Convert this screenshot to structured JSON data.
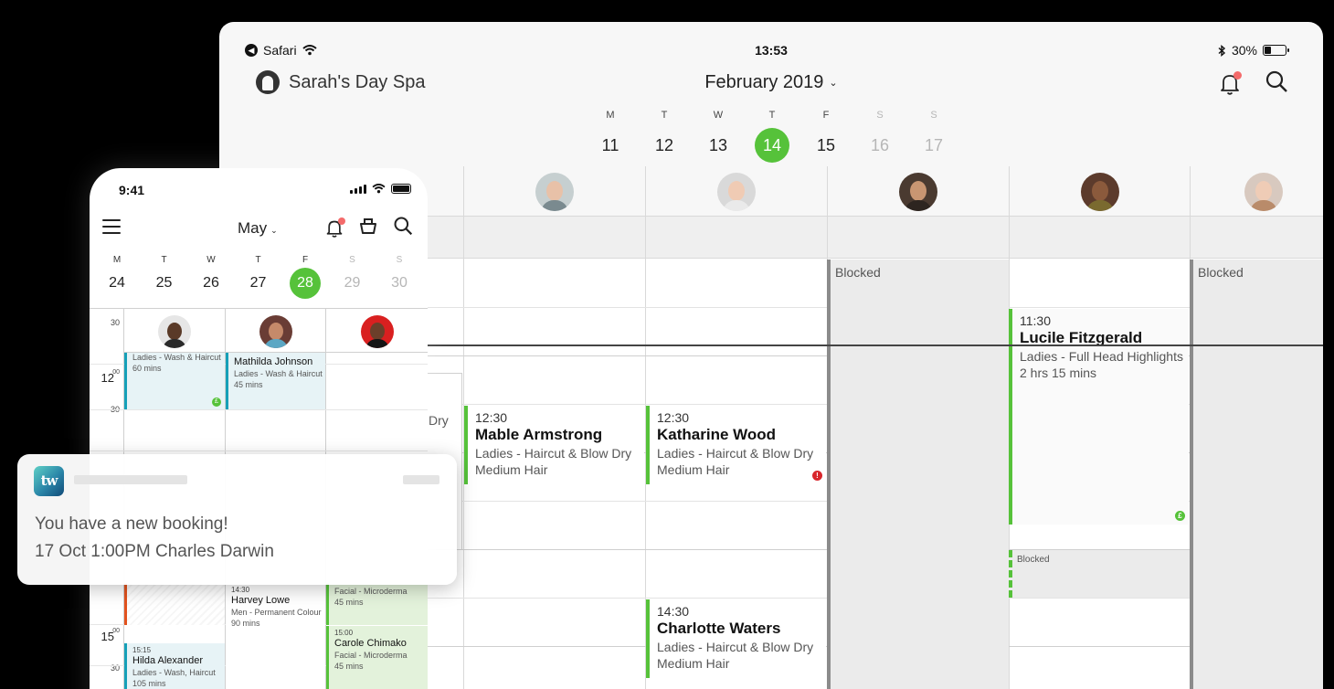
{
  "tablet": {
    "status": {
      "back_app": "Safari",
      "time": "13:53",
      "battery": "30%",
      "battery_level": 0.3
    },
    "business_name": "Sarah's Day Spa",
    "month": "February 2019",
    "week": [
      {
        "label": "M",
        "num": "11"
      },
      {
        "label": "T",
        "num": "12"
      },
      {
        "label": "W",
        "num": "13"
      },
      {
        "label": "T",
        "num": "14",
        "selected": true
      },
      {
        "label": "F",
        "num": "15"
      },
      {
        "label": "S",
        "num": "16",
        "weekend": true
      },
      {
        "label": "S",
        "num": "17",
        "weekend": true
      }
    ],
    "blocked_label": "Blocked",
    "appointments": [
      {
        "time": "12:30",
        "name": "Mable Armstrong",
        "service": "Ladies - Haircut & Blow Dry",
        "detail": "Medium Hair"
      },
      {
        "time": "12:30",
        "name": "Katharine Wood",
        "service": "Ladies - Haircut & Blow Dry",
        "detail": "Medium Hair"
      },
      {
        "time": "11:30",
        "name": "Lucile Fitzgerald",
        "service": "Ladies - Full Head Highlights",
        "detail": "2 hrs 15 mins"
      },
      {
        "time": "14:30",
        "name": "Charlotte Waters",
        "service": "Ladies - Haircut & Blow Dry",
        "detail": "Medium Hair"
      }
    ],
    "partial_text": {
      "left_1": "w Dry",
      "left_2": ")"
    },
    "colors": {
      "accent": "#56c23a",
      "alert": "#d8262c",
      "blocked_border": "#8b8b8b"
    }
  },
  "phone": {
    "status": {
      "time": "9:41"
    },
    "month": "May",
    "week": [
      {
        "label": "M",
        "num": "24"
      },
      {
        "label": "T",
        "num": "25"
      },
      {
        "label": "W",
        "num": "26"
      },
      {
        "label": "T",
        "num": "27"
      },
      {
        "label": "F",
        "num": "28",
        "selected": true
      },
      {
        "label": "S",
        "num": "29",
        "weekend": true
      },
      {
        "label": "S",
        "num": "30",
        "weekend": true
      }
    ],
    "times": {
      "t1": "30",
      "t2": "12",
      "t2_sup": "00",
      "t3": "30",
      "t4": "15",
      "t4_sup": "00",
      "t5": "30"
    },
    "appointments": [
      {
        "service": "Ladies - Wash & Haircut",
        "detail": "60 mins"
      },
      {
        "name": "Mathilda Johnson",
        "service": "Ladies - Wash & Haircut",
        "detail": "45 mins"
      },
      {
        "time": "14:30",
        "name": "Harvey Lowe",
        "service": "Men - Permanent Colour",
        "detail": "90 mins"
      },
      {
        "service": "Facial - Microderma",
        "detail": "45 mins"
      },
      {
        "time": "15:00",
        "name": "Carole Chimako",
        "service": "Facial - Microderma",
        "detail": "45 mins"
      },
      {
        "time": "15:15",
        "name": "Hilda Alexander",
        "service": "Ladies - Wash, Haircut",
        "detail": "105 mins"
      }
    ]
  },
  "notification": {
    "logo": "tw",
    "line1": "You have a new booking!",
    "line2": "17 Oct 1:00PM Charles Darwin"
  }
}
